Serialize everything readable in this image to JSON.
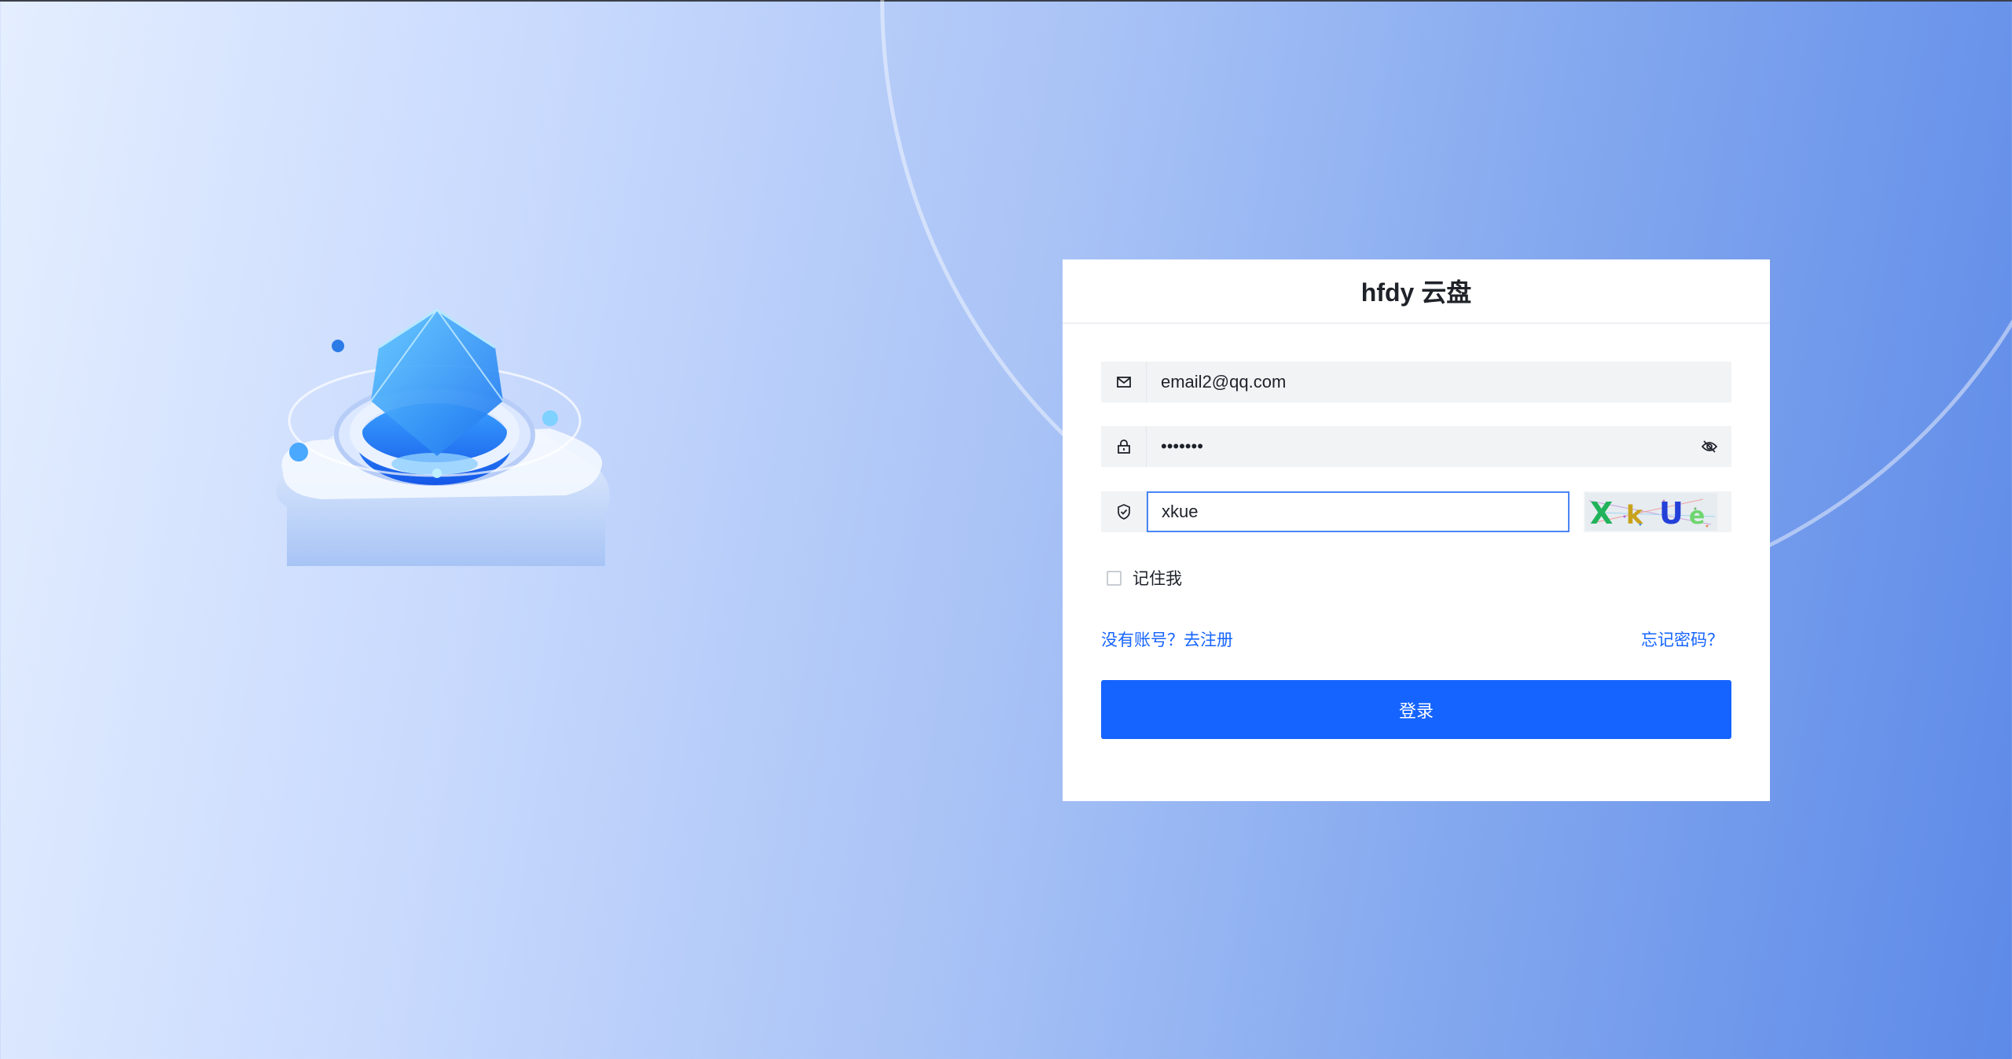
{
  "app": {
    "title": "hfdy 云盘"
  },
  "form": {
    "email": {
      "value": "email2@qq.com",
      "icon": "mail-icon"
    },
    "password": {
      "value": "•••••••",
      "icon": "lock-icon",
      "toggle_icon": "eye-off-icon"
    },
    "captcha": {
      "value": "xkue",
      "icon": "shield-check-icon",
      "image_text": "XkUe"
    },
    "remember_label": "记住我",
    "remember_checked": false,
    "register_link": "没有账号？去注册",
    "forgot_link": "忘记密码？",
    "submit_label": "登录"
  },
  "colors": {
    "primary": "#1664ff",
    "focus_border": "#4a86f5",
    "input_bg": "#f2f3f5"
  }
}
